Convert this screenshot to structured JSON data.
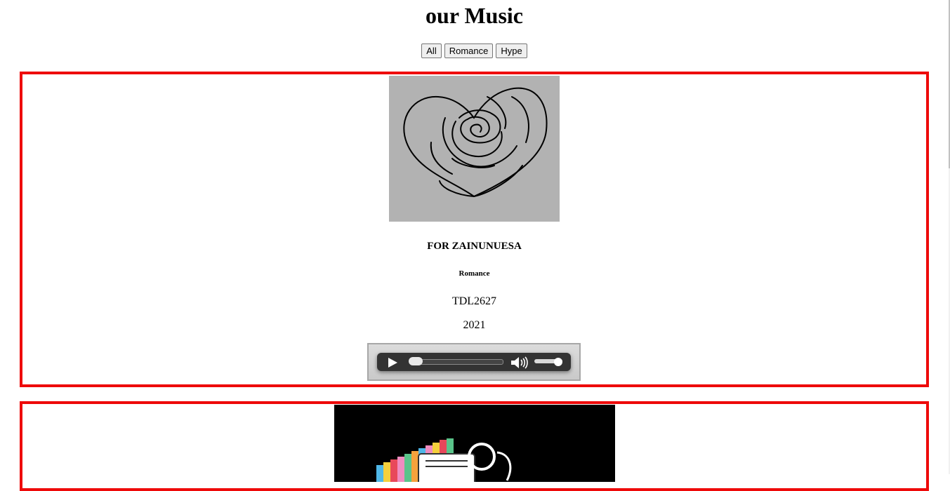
{
  "page": {
    "title": "our Music"
  },
  "filters": [
    {
      "label": "All"
    },
    {
      "label": "Romance"
    },
    {
      "label": "Hype"
    }
  ],
  "tracks": [
    {
      "cover_icon": "rose-heart-drawing",
      "title": "FOR ZAINUNUESA",
      "genre": "Romance",
      "code": "TDL2627",
      "year": "2021",
      "player": {
        "progress": 0.0,
        "volume": 1.0
      }
    },
    {
      "cover_icon": "rainbow-radio-drawing"
    }
  ],
  "colors": {
    "card_border": "#ee0a0a",
    "cover1_bg": "#b2b2b2",
    "cover2_bg": "#000000"
  }
}
